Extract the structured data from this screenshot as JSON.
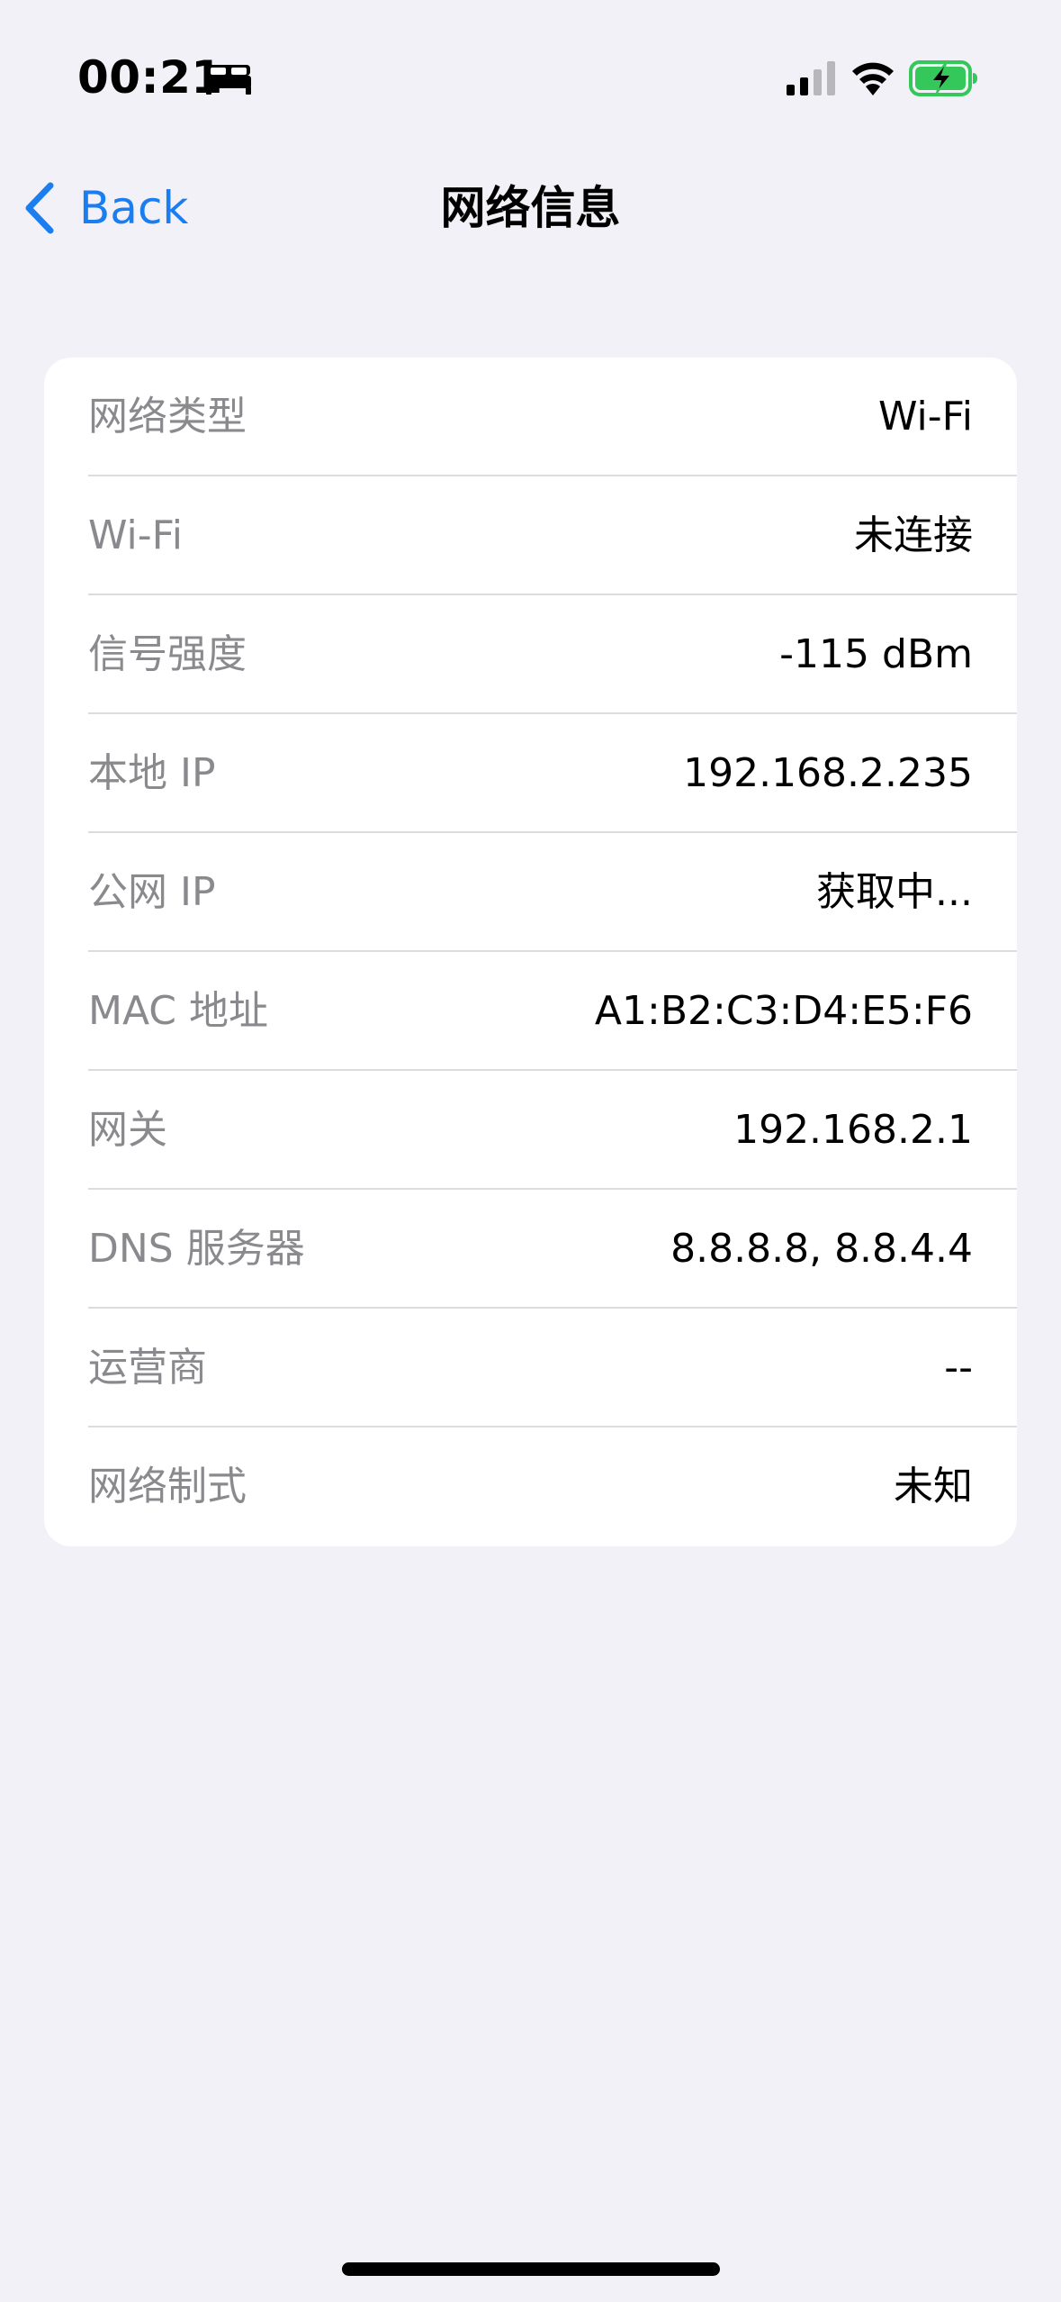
{
  "status_bar": {
    "time": "00:21",
    "sleep_icon": "bed-icon",
    "cellular_icon": "cellular-signal-icon",
    "wifi_icon": "wifi-icon",
    "battery_icon": "battery-charging-icon",
    "battery_color": "#34c759"
  },
  "nav": {
    "back_label": "Back",
    "title": "网络信息",
    "accent_color": "#1a7df0"
  },
  "info": {
    "rows": [
      {
        "label": "网络类型",
        "value": "Wi-Fi"
      },
      {
        "label": "Wi-Fi",
        "value": "未连接"
      },
      {
        "label": "信号强度",
        "value": "-115 dBm"
      },
      {
        "label": "本地 IP",
        "value": "192.168.2.235"
      },
      {
        "label": "公网 IP",
        "value": "获取中..."
      },
      {
        "label": "MAC 地址",
        "value": "A1:B2:C3:D4:E5:F6"
      },
      {
        "label": "网关",
        "value": "192.168.2.1"
      },
      {
        "label": "DNS 服务器",
        "value": "8.8.8.8, 8.8.4.4"
      },
      {
        "label": "运营商",
        "value": "--"
      },
      {
        "label": "网络制式",
        "value": "未知"
      }
    ]
  }
}
